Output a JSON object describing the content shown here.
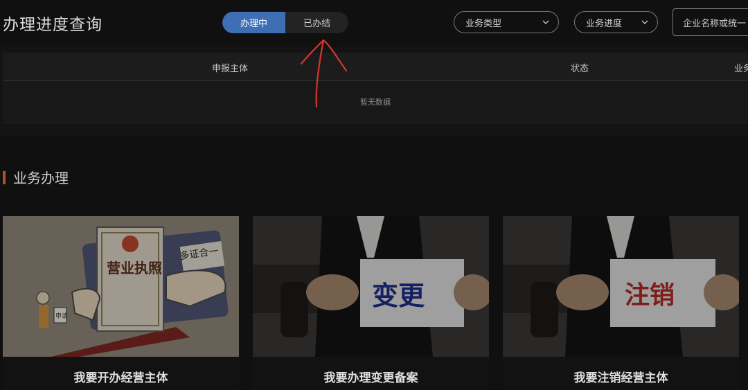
{
  "page_title": "办理进度查询",
  "status_toggle": {
    "options": [
      "办理中",
      "已办结"
    ],
    "active": "办理中"
  },
  "filters": {
    "business_type": {
      "label": "业务类型"
    },
    "business_progress": {
      "label": "业务进度"
    },
    "search": {
      "placeholder": "企业名称或统一"
    }
  },
  "table": {
    "columns": [
      "申报主体",
      "状态",
      "业务"
    ],
    "empty_text": "暂无数据"
  },
  "section": {
    "title": "业务办理"
  },
  "cards": [
    {
      "caption": "我要开办经营主体",
      "image_text": [
        "营业执照",
        "多证合一",
        "申请"
      ]
    },
    {
      "caption": "我要办理变更备案",
      "image_text": [
        "变更"
      ]
    },
    {
      "caption": "我要注销经营主体",
      "image_text": [
        "注销"
      ]
    }
  ],
  "colors": {
    "accent": "#3e6fb5",
    "section_marker": "#b4502a",
    "annotation": "#d7362b",
    "background": "#101010"
  },
  "icons": [
    "chevron-down-icon"
  ]
}
